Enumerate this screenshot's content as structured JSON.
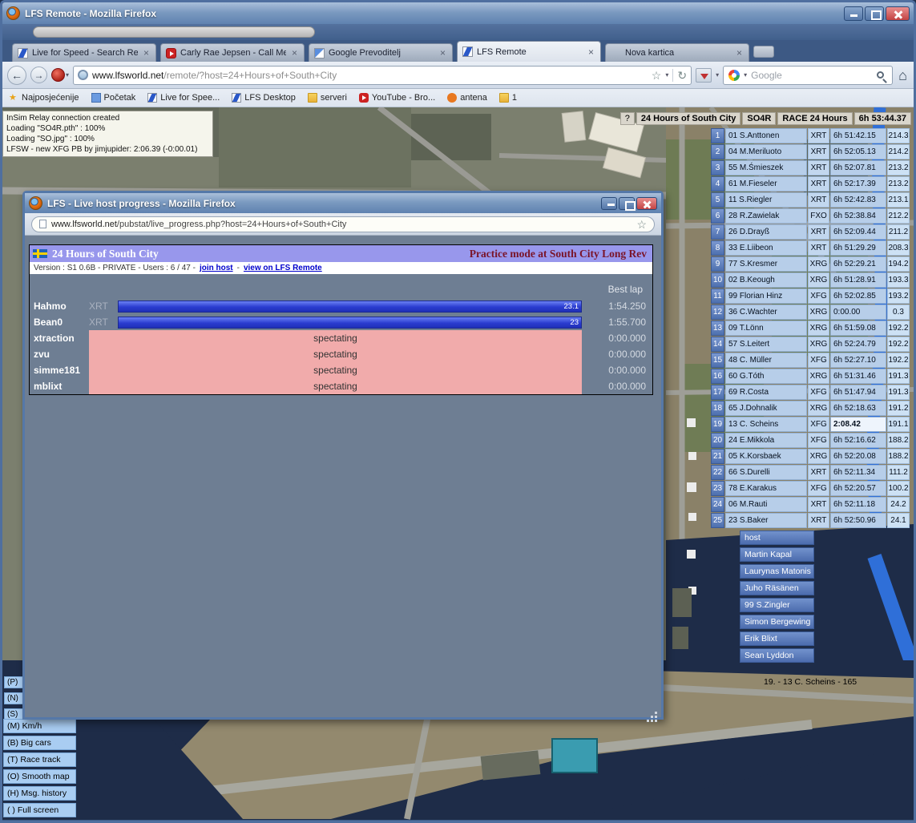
{
  "main_window": {
    "title": "LFS Remote - Mozilla Firefox",
    "tabs": [
      {
        "label": "Live for Speed - Search Re...",
        "icon": "lfs",
        "state": "inactive"
      },
      {
        "label": "Carly Rae Jepsen - Call Me ...",
        "icon": "youtube",
        "state": "inactive"
      },
      {
        "label": "Google Prevoditelj",
        "icon": "translate",
        "state": "inactive"
      },
      {
        "label": "LFS Remote",
        "icon": "lfs",
        "state": "active"
      },
      {
        "label": "Nova kartica",
        "icon": "blank",
        "state": "inactive"
      }
    ],
    "nav": {
      "url_host": "www.lfsworld.net",
      "url_path": "/remote/?host=24+Hours+of+South+City",
      "search_placeholder": "Google"
    },
    "bookmarks": [
      {
        "label": "Najposjećenije",
        "icon": "star"
      },
      {
        "label": "Početak",
        "icon": "page"
      },
      {
        "label": "Live for Spee...",
        "icon": "lfs"
      },
      {
        "label": "LFS Desktop",
        "icon": "lfs"
      },
      {
        "label": "serveri",
        "icon": "folder"
      },
      {
        "label": "YouTube - Bro...",
        "icon": "youtube"
      },
      {
        "label": "antena",
        "icon": "dot"
      },
      {
        "label": "1",
        "icon": "folder"
      }
    ],
    "icons": {
      "back": "←",
      "forward": "→",
      "star": "☆",
      "reload": "↻",
      "caret": "▾",
      "close": "×",
      "home": "⌂"
    }
  },
  "remote": {
    "messages": [
      "InSim Relay connection created",
      "Loading \"SO4R.pth\" : 100%",
      "Loading \"SO.jpg\" : 100%",
      "LFSW - new XFG PB by jimjupider: 2:06.39 (-0:00.01)"
    ],
    "status": {
      "help": "?",
      "host": "24 Hours of South City",
      "track": "SO4R",
      "session": "RACE 24 Hours",
      "clock": "6h 53:44.37"
    },
    "leaderboard": [
      {
        "pos": "1",
        "entry": "01 S.Anttonen",
        "car": "XRT",
        "time": "6h 51:42.15",
        "spd": "214.3"
      },
      {
        "pos": "2",
        "entry": "04 M.Meriluoto",
        "car": "XRT",
        "time": "6h 52:05.13",
        "spd": "214.2"
      },
      {
        "pos": "3",
        "entry": "55 M.Śmieszek",
        "car": "XRT",
        "time": "6h 52:07.81",
        "spd": "213.2"
      },
      {
        "pos": "4",
        "entry": "61 M.Fieseler",
        "car": "XRT",
        "time": "6h 52:17.39",
        "spd": "213.2"
      },
      {
        "pos": "5",
        "entry": "11 S.Riegler",
        "car": "XRT",
        "time": "6h 52:42.83",
        "spd": "213.1"
      },
      {
        "pos": "6",
        "entry": "28 R.Zawielak",
        "car": "FXO",
        "time": "6h 52:38.84",
        "spd": "212.2"
      },
      {
        "pos": "7",
        "entry": "26 D.Drayß",
        "car": "XRT",
        "time": "6h 52:09.44",
        "spd": "211.2"
      },
      {
        "pos": "8",
        "entry": "33 E.Liibeon",
        "car": "XRT",
        "time": "6h 51:29.29",
        "spd": "208.3"
      },
      {
        "pos": "9",
        "entry": "77 S.Kresmer",
        "car": "XRG",
        "time": "6h 52:29.21",
        "spd": "194.2"
      },
      {
        "pos": "10",
        "entry": "02 B.Keough",
        "car": "XRG",
        "time": "6h 51:28.91",
        "spd": "193.3"
      },
      {
        "pos": "11",
        "entry": "99 Florian Hinz",
        "car": "XFG",
        "time": "6h 52:02.85",
        "spd": "193.2"
      },
      {
        "pos": "12",
        "entry": "36 C.Wachter",
        "car": "XRG",
        "time": "0:00.00",
        "spd": "0.3"
      },
      {
        "pos": "13",
        "entry": "09 T.Lönn",
        "car": "XRG",
        "time": "6h 51:59.08",
        "spd": "192.2"
      },
      {
        "pos": "14",
        "entry": "57 S.Leitert",
        "car": "XRG",
        "time": "6h 52:24.79",
        "spd": "192.2"
      },
      {
        "pos": "15",
        "entry": "48 C. Müller",
        "car": "XFG",
        "time": "6h 52:27.10",
        "spd": "192.2"
      },
      {
        "pos": "16",
        "entry": "60 G.Tóth",
        "car": "XRG",
        "time": "6h 51:31.46",
        "spd": "191.3"
      },
      {
        "pos": "17",
        "entry": "69 R.Costa",
        "car": "XFG",
        "time": "6h 51:47.94",
        "spd": "191.3"
      },
      {
        "pos": "18",
        "entry": "65 J.Dohnalik",
        "car": "XRG",
        "time": "6h 52:18.63",
        "spd": "191.2"
      },
      {
        "pos": "19",
        "entry": "13 C. Scheins",
        "car": "XFG",
        "time": "2:08.42",
        "spd": "191.1",
        "cls": "current"
      },
      {
        "pos": "20",
        "entry": "24 E.Mikkola",
        "car": "XFG",
        "time": "6h 52:16.62",
        "spd": "188.2"
      },
      {
        "pos": "21",
        "entry": "05 K.Korsbaek",
        "car": "XRG",
        "time": "6h 52:20.08",
        "spd": "188.2"
      },
      {
        "pos": "22",
        "entry": "66 S.Durelli",
        "car": "XRT",
        "time": "6h 52:11.34",
        "spd": "111.2"
      },
      {
        "pos": "23",
        "entry": "78 E.Karakus",
        "car": "XFG",
        "time": "6h 52:20.57",
        "spd": "100.2"
      },
      {
        "pos": "24",
        "entry": "06 M.Rauti",
        "car": "XRT",
        "time": "6h 52:11.18",
        "spd": "24.2"
      },
      {
        "pos": "25",
        "entry": "23 S.Baker",
        "car": "XRT",
        "time": "6h 52:50.96",
        "spd": "24.1"
      }
    ],
    "hosts": {
      "label": "host",
      "names": [
        "Martin Kapal",
        "Laurynas Matonis",
        "Juho Räsänen",
        "99 S.Zingler",
        "Simon Bergewing",
        "Erik Blixt",
        "Sean Lyddon"
      ]
    },
    "side_buttons": [
      "(P)",
      "(N)",
      "(S)"
    ],
    "view_buttons": [
      "(M) Km/h",
      "(B) Big cars",
      "(T) Race track",
      "(O) Smooth map",
      "(H) Msg. history",
      "( ) Full screen"
    ],
    "footer_note": "19. - 13 C. Scheins - 165"
  },
  "popup": {
    "title": "LFS - Live host progress - Mozilla Firefox",
    "url_host": "www.lfsworld.net",
    "url_path": "/pubstat/live_progress.php?host=24+Hours+of+South+City",
    "header": {
      "title": "24 Hours of South City",
      "mode": "Practice mode at South City Long Rev"
    },
    "meta": {
      "info": "Version : S1 0.6B - PRIVATE - Users : 6 / 47 -",
      "join_link": "join host",
      "sep": "-",
      "view_link": "view on LFS Remote"
    },
    "best_lap_label": "Best lap",
    "racers": [
      {
        "name": "Hahmo",
        "car": "XRT",
        "laps": "23.1",
        "best": "1:54.250"
      },
      {
        "name": "Bean0",
        "car": "XRT",
        "laps": "23",
        "best": "1:55.700"
      }
    ],
    "spectators": [
      {
        "name": "xtraction",
        "status": "spectating",
        "best": "0:00.000"
      },
      {
        "name": "zvu",
        "status": "spectating",
        "best": "0:00.000"
      },
      {
        "name": "simme181",
        "status": "spectating",
        "best": "0:00.000"
      },
      {
        "name": "mblixt",
        "status": "spectating",
        "best": "0:00.000"
      }
    ]
  }
}
